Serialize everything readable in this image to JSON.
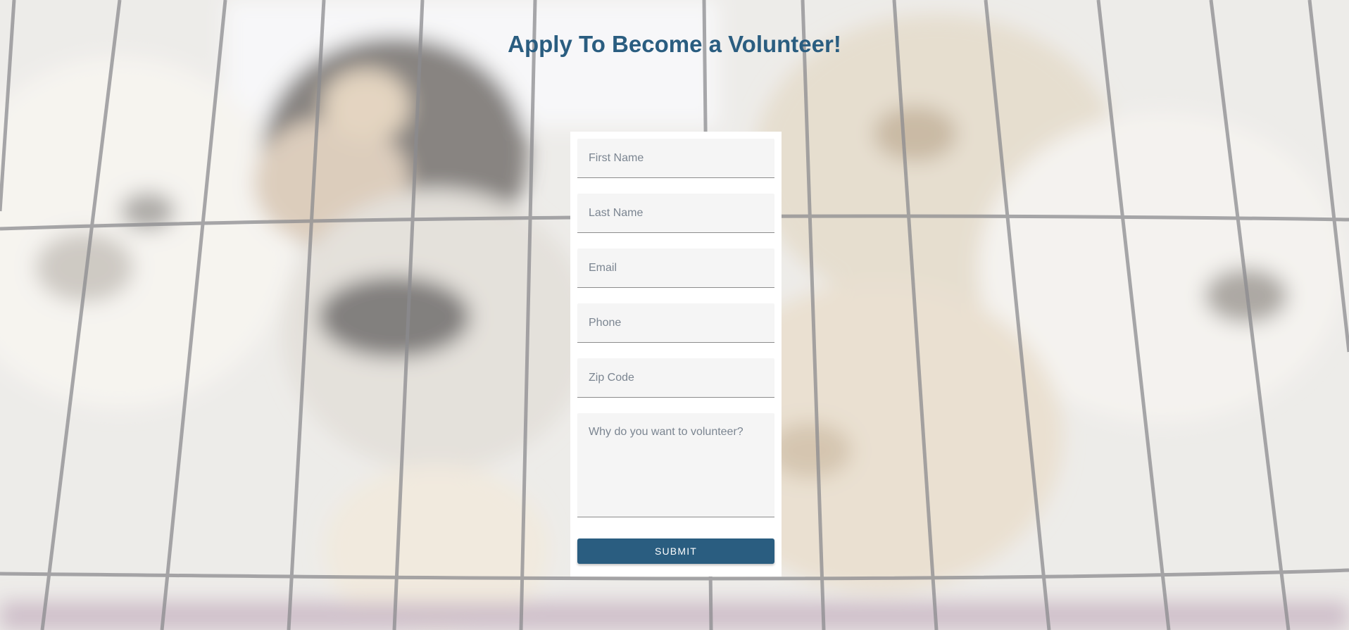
{
  "page": {
    "title": "Apply To Become a Volunteer!"
  },
  "form": {
    "first_name_placeholder": "First Name",
    "last_name_placeholder": "Last Name",
    "email_placeholder": "Email",
    "phone_placeholder": "Phone",
    "zip_placeholder": "Zip Code",
    "reason_placeholder": "Why do you want to volunteer?",
    "submit_label": "SUBMIT"
  },
  "colors": {
    "accent": "#2a5d80",
    "card_background": "#ffffff",
    "field_background": "#f5f5f5"
  }
}
